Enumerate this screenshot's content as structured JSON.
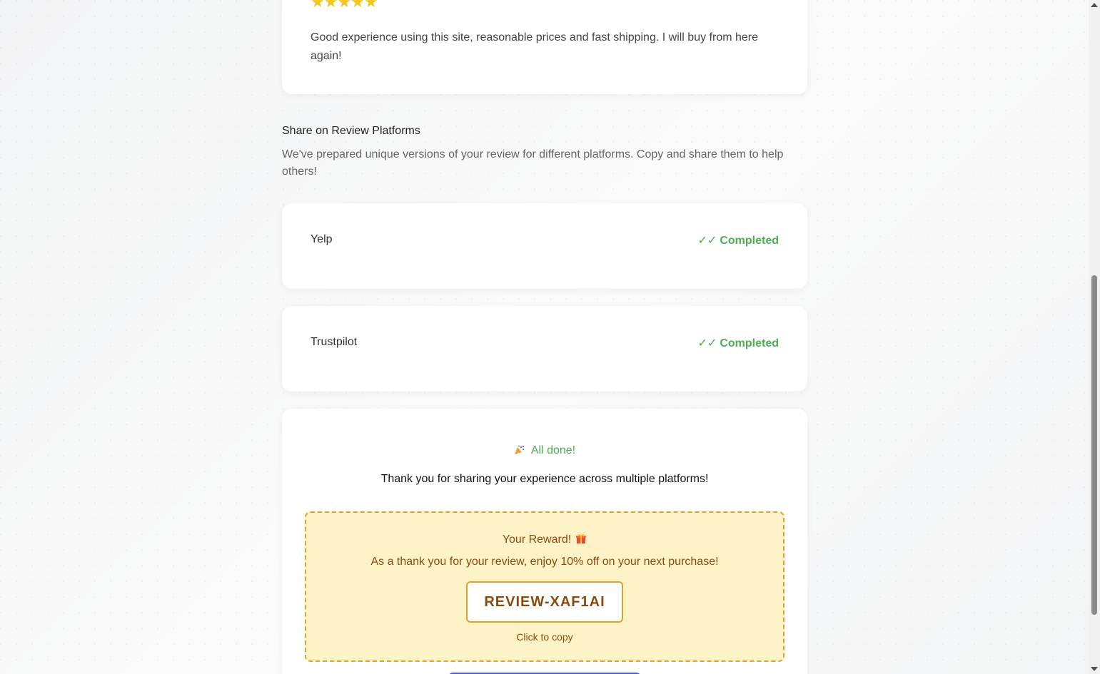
{
  "review": {
    "stars": "★★★★★",
    "text": "Good experience using this site, reasonable prices and fast shipping. I will buy from here again!"
  },
  "share": {
    "title": "Share on Review Platforms",
    "description": "We've prepared unique versions of your review for different platforms. Copy and share them to help others!",
    "platforms": [
      {
        "name": "Yelp",
        "status_icon": "✓✓",
        "status": "Completed"
      },
      {
        "name": "Trustpilot",
        "status_icon": "✓✓",
        "status": "Completed"
      }
    ]
  },
  "completion": {
    "heading": "All done!",
    "heading_icon": "party-popper-icon",
    "message": "Thank you for sharing your experience across multiple platforms!"
  },
  "reward": {
    "title": "Your Reward!",
    "title_icon": "gift-icon",
    "description": "As a thank you for your review, enjoy 10% off on your next purchase!",
    "code": "REVIEW-XAF1AI",
    "copy_hint": "Click to copy"
  },
  "colors": {
    "success": "#4caf50",
    "star": "#f5c518",
    "reward_bg": "#fdf3c6",
    "reward_border": "#e0a326",
    "reward_text": "#8a4a10"
  }
}
